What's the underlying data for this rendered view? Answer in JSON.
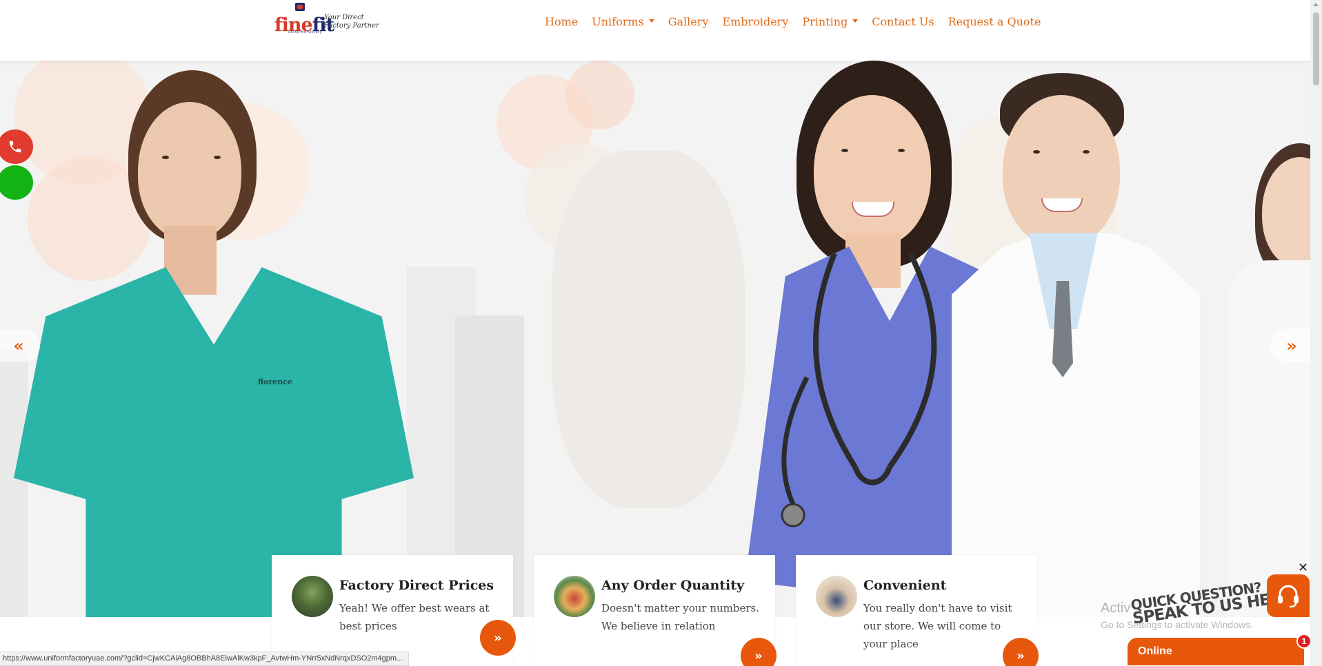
{
  "header": {
    "logo": {
      "brand_part1": "fine",
      "brand_part2": "fit",
      "tagline": "Your Direct Factory Partner",
      "sub": "uniforms factory"
    },
    "nav": [
      {
        "label": "Home",
        "dropdown": false
      },
      {
        "label": "Uniforms",
        "dropdown": true
      },
      {
        "label": "Gallery",
        "dropdown": false
      },
      {
        "label": "Embroidery",
        "dropdown": false
      },
      {
        "label": "Printing",
        "dropdown": true
      },
      {
        "label": "Contact Us",
        "dropdown": false
      },
      {
        "label": "Request a Quote",
        "dropdown": false
      }
    ]
  },
  "hero": {
    "prev_icon": "double-chevron-left-icon",
    "next_icon": "double-chevron-right-icon",
    "prev_glyph": "«",
    "next_glyph": "»",
    "shirt_logo_text": "florence"
  },
  "side_buttons": {
    "phone": {
      "icon": "phone-icon",
      "color": "#e03b2e"
    },
    "whatsapp": {
      "icon": "whatsapp-icon",
      "color": "#12b312"
    }
  },
  "features": [
    {
      "title": "Factory Direct Prices",
      "text": "Yeah! We offer best wears at best prices",
      "thumb_icon": "plant-coins-icon",
      "arrow": "»"
    },
    {
      "title": "Any Order Quantity",
      "text": "Doesn't matter your numbers. We believe in relation",
      "thumb_icon": "shopping-bags-icon",
      "arrow": "»"
    },
    {
      "title": "Convenient",
      "text": "You really don't have to visit our store. We will come to your place",
      "thumb_icon": "meeting-icon",
      "arrow": "»"
    }
  ],
  "chat": {
    "close": "✕",
    "bubble_line1": "QUICK QUESTION?",
    "bubble_line2": "SPEAK TO US HERE!",
    "status": "Online",
    "badge": "1",
    "icon": "headset-icon"
  },
  "windows_activation": {
    "line1": "Activ",
    "line2": "Go to Settings to activate Windows."
  },
  "status_url": "https://www.uniformfactoryuae.com/?gclid=CjwKCAiAg8OBBhA8EiwAlKw3kpF_AvtwHm-YNrr5xNdNrqxDSO2m4gpm...",
  "colors": {
    "accent": "#e06a19",
    "button": "#e8580c"
  }
}
